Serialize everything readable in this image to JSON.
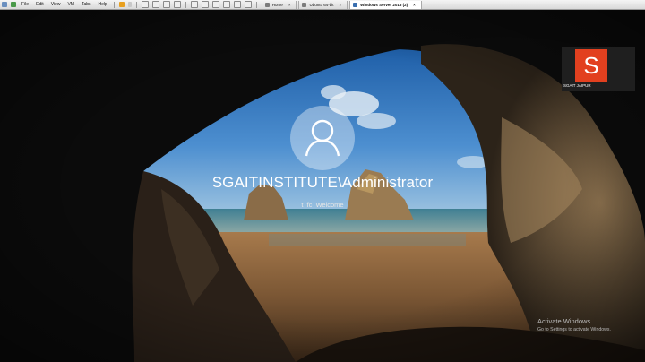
{
  "toolbar": {
    "menu": [
      "File",
      "Edit",
      "View",
      "VM",
      "Tabs",
      "Help"
    ],
    "tabs": [
      {
        "label": "Home",
        "active": false
      },
      {
        "label": "Ubuntu 64-bit",
        "active": false
      },
      {
        "label": "Windows Server 2016 (2)",
        "active": true
      }
    ]
  },
  "login": {
    "username": "SGAITINSTITUTE\\Administrator",
    "status": "t fc Welcome"
  },
  "logo": {
    "letter": "S",
    "caption": "SGAIT JAIPUR",
    "color": "#e2401f"
  },
  "watermark": {
    "title": "Activate Windows",
    "subtitle": "Go to Settings to activate Windows."
  }
}
